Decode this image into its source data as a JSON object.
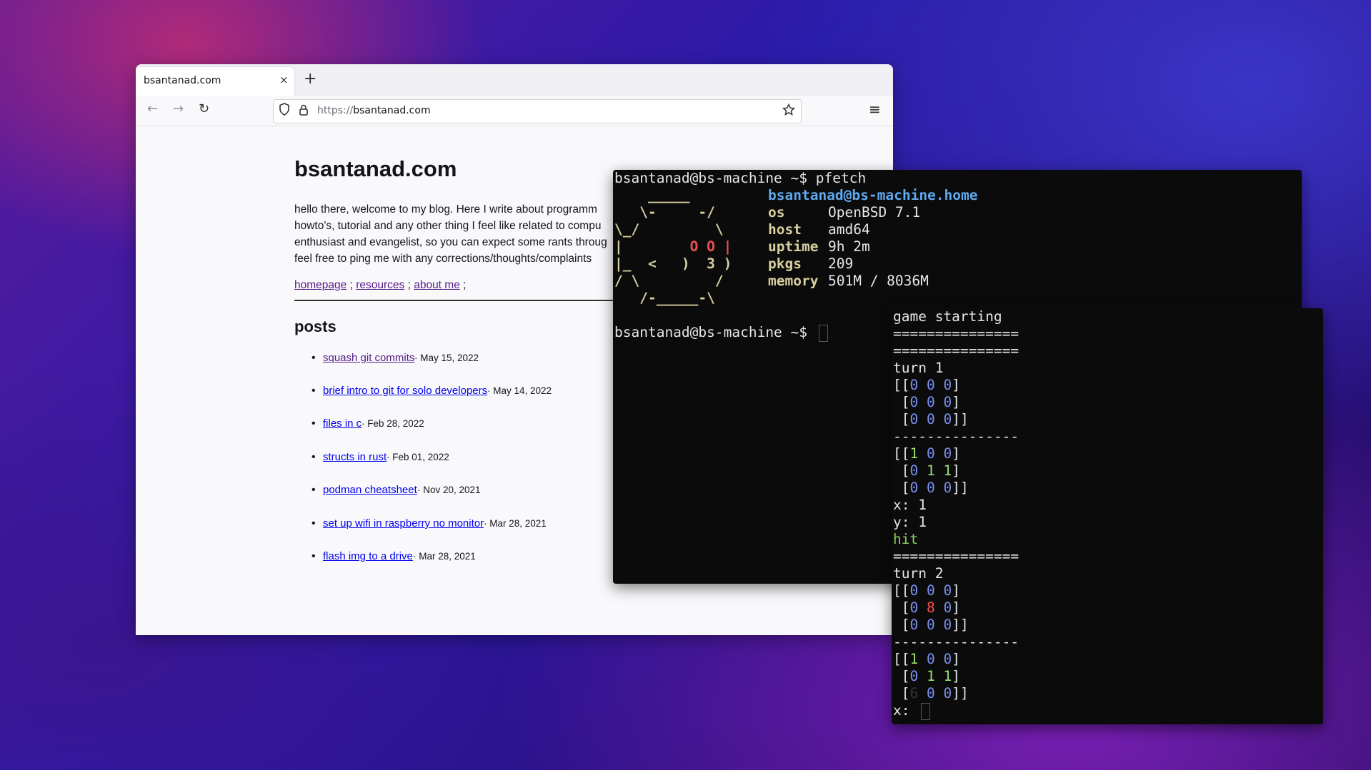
{
  "browser": {
    "tab_title": "bsantanad.com",
    "tab_close": "×",
    "new_tab": "+",
    "back": "←",
    "forward": "→",
    "reload": "↻",
    "url_protocol": "https://",
    "url_host": "bsantanad.com",
    "menu": "≡"
  },
  "page": {
    "title": "bsantanad.com",
    "intro_lines": [
      "hello there, welcome to my blog. Here I write about programm",
      "howto's, tutorial and any other thing I feel like related to compu",
      "enthusiast and evangelist, so you can expect some rants throug",
      "feel free to ping me with any corrections/thoughts/complaints"
    ],
    "nav": [
      {
        "label": "homepage"
      },
      {
        "label": "resources"
      },
      {
        "label": "about me"
      }
    ],
    "nav_sep": ";",
    "posts_heading": "posts",
    "posts": [
      {
        "title": "squash git commits",
        "date": "May 15, 2022",
        "visited": true
      },
      {
        "title": "brief intro to git for solo developers",
        "date": "May 14, 2022",
        "visited": false
      },
      {
        "title": "files in c",
        "date": "Feb 28, 2022",
        "visited": false
      },
      {
        "title": "structs in rust",
        "date": "Feb 01, 2022",
        "visited": false
      },
      {
        "title": "podman cheatsheet",
        "date": "Nov 20, 2021",
        "visited": false
      },
      {
        "title": "set up wifi in raspberry no monitor",
        "date": "Mar 28, 2021",
        "visited": false
      },
      {
        "title": "flash img to a drive",
        "date": "Mar 28, 2021",
        "visited": false
      }
    ]
  },
  "terminal1": {
    "prompt": "bsantanad@bs-machine ~$ ",
    "command": "pfetch",
    "logo": [
      "    _____",
      "   \\-     -/",
      "\\_/         \\",
      "|        ",
      "|_  <   )  3 )",
      "/ \\         /",
      "   /-_____-\\"
    ],
    "logo_eyes": "O O |",
    "user_host": "bsantanad@bs-machine.home",
    "info": [
      {
        "key": "os",
        "value": "OpenBSD 7.1"
      },
      {
        "key": "host",
        "value": "amd64"
      },
      {
        "key": "uptime",
        "value": "9h 2m"
      },
      {
        "key": "pkgs",
        "value": "209"
      },
      {
        "key": "memory",
        "value": "501M / 8036M"
      }
    ],
    "prompt2": "bsantanad@bs-machine ~$ "
  },
  "terminal2": {
    "game_start": "game starting",
    "sep_eq": "===============",
    "sep_dash": "---------------",
    "turn1": "turn 1",
    "turn2": "turn 2",
    "x1": "x: 1",
    "y1": "y: 1",
    "hit": "hit",
    "x_prompt": "x: "
  }
}
